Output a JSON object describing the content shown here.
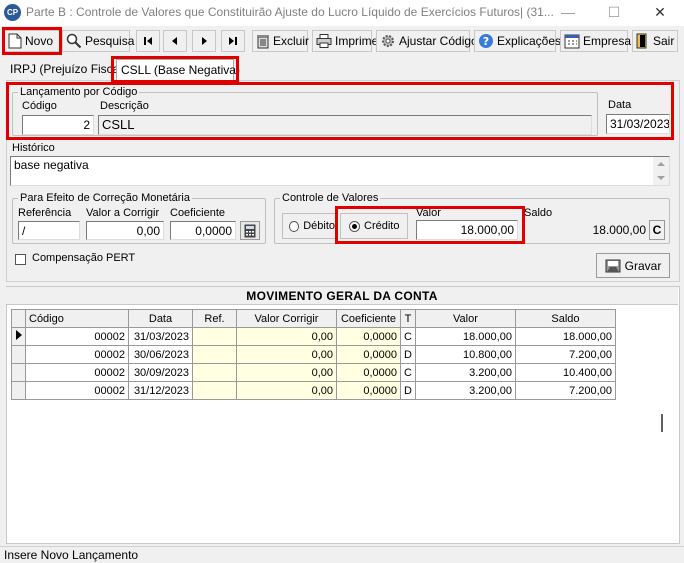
{
  "window": {
    "app_icon_text": "CP",
    "title": "Parte B : Controle de Valores que Constituirão Ajuste do Lucro Líquido de Exercícios Futuros| (31...",
    "minimize": "—",
    "maximize": "☐",
    "close": "✕"
  },
  "toolbar": {
    "novo": "Novo",
    "pesquisa": "Pesquisa",
    "excluir": "Excluir",
    "imprime": "Imprime",
    "ajustar_codigo": "Ajustar Código",
    "explicacoes": "Explicações",
    "empresa": "Empresa",
    "sair": "Sair"
  },
  "tabs": [
    {
      "label": "IRPJ (Prejuízo Fiscal)"
    },
    {
      "label": "CSLL (Base Negativa)"
    }
  ],
  "lancamento": {
    "legend": "Lançamento por Código",
    "codigo_label": "Código",
    "codigo_value": "2",
    "descricao_label": "Descrição",
    "descricao_value": "CSLL",
    "data_label": "Data",
    "data_value": "31/03/2023"
  },
  "historico": {
    "label": "Histórico",
    "value": "base negativa"
  },
  "correcao": {
    "legend": "Para Efeito de Correção Monetária",
    "referencia_label": "Referência",
    "referencia_value": "/",
    "valor_corrigir_label": "Valor a Corrigir",
    "valor_corrigir_value": "0,00",
    "coeficiente_label": "Coeficiente",
    "coeficiente_value": "0,0000"
  },
  "controle": {
    "legend": "Controle de Valores",
    "debito_label": "Débito",
    "credito_label": "Crédito",
    "selected": "credito",
    "valor_label": "Valor",
    "valor_value": "18.000,00",
    "saldo_label": "Saldo",
    "saldo_value": "18.000,00",
    "saldo_tipo": "C"
  },
  "compensacao_pert": {
    "label": "Compensação PERT",
    "checked": false
  },
  "gravar_label": "Gravar",
  "grid": {
    "title": "MOVIMENTO GERAL DA CONTA",
    "columns": [
      "Código",
      "Data",
      "Ref.",
      "Valor Corrigir",
      "Coeficiente",
      "T",
      "Valor",
      "Saldo"
    ],
    "rows": [
      {
        "codigo": "00002",
        "data": "31/03/2023",
        "ref": "",
        "valor_corrigir": "0,00",
        "coeficiente": "0,0000",
        "t": "C",
        "valor": "18.000,00",
        "saldo": "18.000,00"
      },
      {
        "codigo": "00002",
        "data": "30/06/2023",
        "ref": "",
        "valor_corrigir": "0,00",
        "coeficiente": "0,0000",
        "t": "D",
        "valor": "10.800,00",
        "saldo": "7.200,00"
      },
      {
        "codigo": "00002",
        "data": "30/09/2023",
        "ref": "",
        "valor_corrigir": "0,00",
        "coeficiente": "0,0000",
        "t": "C",
        "valor": "3.200,00",
        "saldo": "10.400,00"
      },
      {
        "codigo": "00002",
        "data": "31/12/2023",
        "ref": "",
        "valor_corrigir": "0,00",
        "coeficiente": "0,0000",
        "t": "D",
        "valor": "3.200,00",
        "saldo": "7.200,00"
      }
    ]
  },
  "status": "Insere Novo Lançamento",
  "colors": {
    "highlight": "#e00000",
    "yellow_cell": "#ffffe1",
    "background": "#f0f0f0"
  }
}
